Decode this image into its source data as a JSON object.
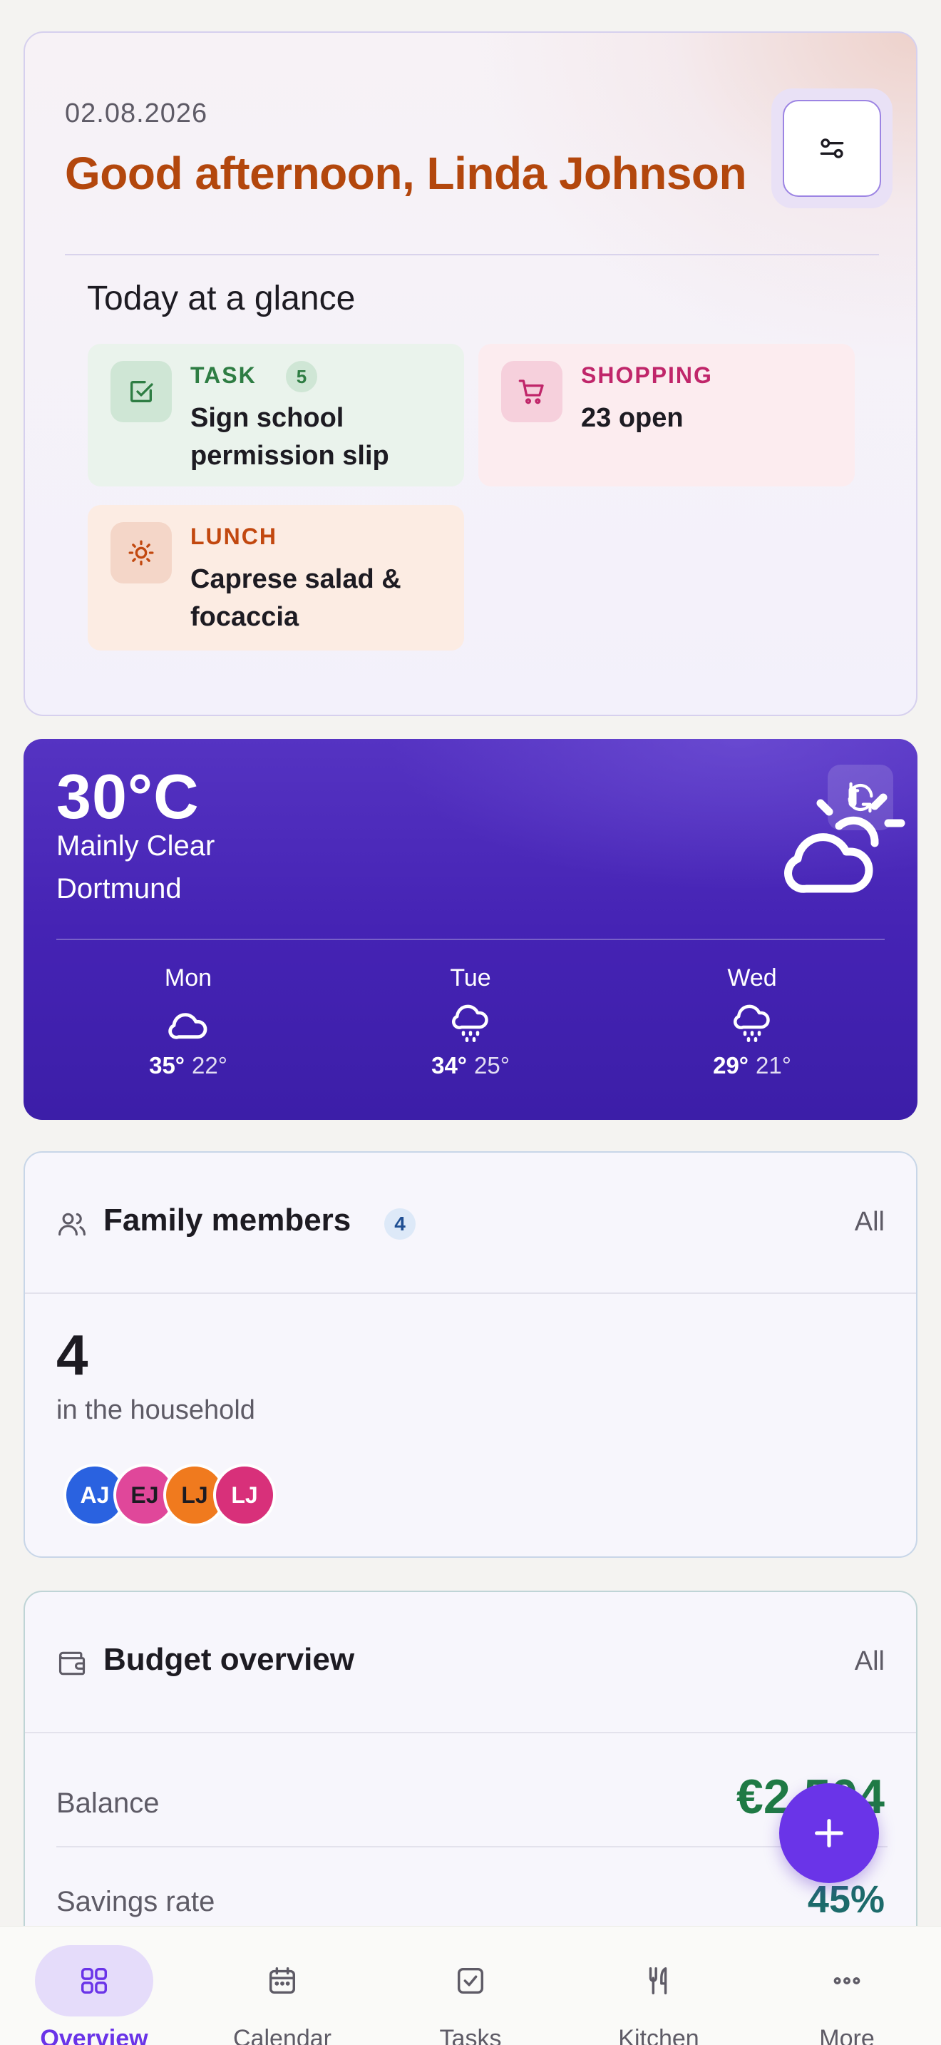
{
  "greeting": {
    "date": "02.08.2026",
    "title": "Good afternoon, Linda Johnson"
  },
  "glance": {
    "title": "Today at a glance",
    "task": {
      "label": "TASK",
      "count": "5",
      "text": "Sign school permission slip",
      "icon": "check-square-icon",
      "color": "#2e7d43"
    },
    "shopping": {
      "label": "SHOPPING",
      "text": "23 open",
      "icon": "cart-icon",
      "color": "#c0266a"
    },
    "lunch": {
      "label": "LUNCH",
      "text": "Caprese salad & focaccia",
      "icon": "sun-icon",
      "color": "#c2480f"
    }
  },
  "weather": {
    "temp": "30°C",
    "condition": "Mainly Clear",
    "city": "Dortmund",
    "icon": "sun-cloud-icon",
    "forecast": [
      {
        "day": "Mon",
        "high": "35°",
        "low": "22°",
        "icon": "cloud-icon"
      },
      {
        "day": "Tue",
        "high": "34°",
        "low": "25°",
        "icon": "cloud-drizzle-icon"
      },
      {
        "day": "Wed",
        "high": "29°",
        "low": "21°",
        "icon": "cloud-drizzle-icon"
      }
    ]
  },
  "family": {
    "title": "Family members",
    "badge": "4",
    "all_label": "All",
    "count": "4",
    "subtitle": "in the household",
    "members": [
      {
        "initials": "AJ",
        "color": "#2a62e0"
      },
      {
        "initials": "EJ",
        "color": "#e0479a"
      },
      {
        "initials": "LJ",
        "color": "#f07a1e"
      },
      {
        "initials": "LJ",
        "color": "#d8307a"
      }
    ]
  },
  "budget": {
    "title": "Budget overview",
    "all_label": "All",
    "balance_label": "Balance",
    "balance_value": "€2,504",
    "savings_label": "Savings rate",
    "savings_value": "45%"
  },
  "nav": {
    "items": [
      {
        "label": "Overview",
        "icon": "grid-icon"
      },
      {
        "label": "Calendar",
        "icon": "calendar-icon"
      },
      {
        "label": "Tasks",
        "icon": "check-box-icon"
      },
      {
        "label": "Kitchen",
        "icon": "utensils-icon"
      },
      {
        "label": "More",
        "icon": "more-dots-icon"
      }
    ]
  },
  "colors": {
    "accent": "#6a34e8",
    "greeting": "#b3470d",
    "positive": "#1f7a45",
    "savings": "#1d6b6b"
  }
}
